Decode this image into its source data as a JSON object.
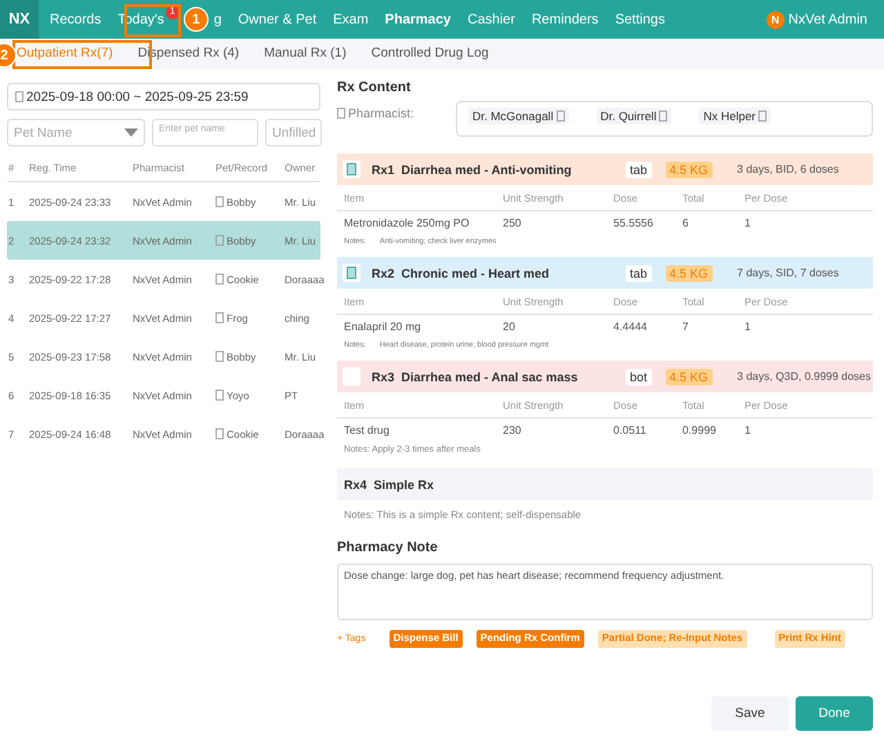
{
  "app": {
    "logo": "NX",
    "user_initial": "N",
    "user_name": "NxVet Admin"
  },
  "nav": [
    {
      "label": "Records",
      "selected": false
    },
    {
      "label": "Today's",
      "selected": false,
      "badge": "1"
    },
    {
      "label": "g",
      "selected": false
    },
    {
      "label": "Owner & Pet",
      "selected": false
    },
    {
      "label": "Exam",
      "selected": false
    },
    {
      "label": "Pharmacy",
      "selected": true
    },
    {
      "label": "Cashier",
      "selected": false
    },
    {
      "label": "Reminders",
      "selected": false
    },
    {
      "label": "Settings",
      "selected": false
    }
  ],
  "tabs": [
    {
      "label": "Outpatient Rx(7)",
      "selected": true
    },
    {
      "label": "Dispensed Rx (4)",
      "selected": false
    },
    {
      "label": "Manual Rx (1)",
      "selected": false
    },
    {
      "label": "Controlled Drug Log",
      "selected": false
    }
  ],
  "annotations": [
    {
      "label": "1"
    },
    {
      "label": "2"
    }
  ],
  "filters": {
    "date_range": "2025-09-18 00:00 ~ 2025-09-25 23:59",
    "pet_select": "Pet Name",
    "pet_input_placeholder": "Enter pet name",
    "status_select": "Unfilled"
  },
  "list": {
    "columns": [
      "#",
      "Reg. Time",
      "Pharmacist",
      "Pet/Record",
      "Owner"
    ],
    "rows": [
      {
        "num": "1",
        "time": "2025-09-24 23:33",
        "pharmacist": "NxVet Admin",
        "pet": "Bobby",
        "owner": "Mr. Liu",
        "selected": false
      },
      {
        "num": "2",
        "time": "2025-09-24 23:32",
        "pharmacist": "NxVet Admin",
        "pet": "Bobby",
        "owner": "Mr. Liu",
        "selected": true
      },
      {
        "num": "3",
        "time": "2025-09-22 17:28",
        "pharmacist": "NxVet Admin",
        "pet": "Cookie",
        "owner": "Doraaaa",
        "selected": false
      },
      {
        "num": "4",
        "time": "2025-09-22 17:27",
        "pharmacist": "NxVet Admin",
        "pet": "Frog",
        "owner": "ching",
        "selected": false
      },
      {
        "num": "5",
        "time": "2025-09-23 17:58",
        "pharmacist": "NxVet Admin",
        "pet": "Bobby",
        "owner": "Mr. Liu",
        "selected": false
      },
      {
        "num": "6",
        "time": "2025-09-18 16:35",
        "pharmacist": "NxVet Admin",
        "pet": "Yoyo",
        "owner": "PT",
        "selected": false
      },
      {
        "num": "7",
        "time": "2025-09-24 16:48",
        "pharmacist": "NxVet Admin",
        "pet": "Cookie",
        "owner": "Doraaaa",
        "selected": false
      }
    ]
  },
  "rx_content": {
    "title": "Rx Content",
    "pharmacist_label": "Pharmacist:",
    "pharmacists": [
      "Dr. McGonagall",
      "Dr. Quirrell",
      "Nx Helper"
    ],
    "prescriptions": [
      {
        "kind": "detailed",
        "code": "Rx1",
        "name": "Diarrhea med - Anti-vomiting",
        "form": "tab",
        "weight": "4.5 KG",
        "schedule": "3 days, BID, 6 doses",
        "color": "#fde5d8",
        "checked": true,
        "columns": [
          "Item",
          "Unit Strength",
          "Dose",
          "Total",
          "Per Dose"
        ],
        "items": [
          [
            "Metronidazole 250mg PO",
            "250",
            "55.5556",
            "6",
            "1"
          ]
        ],
        "notes_label": "Notes:",
        "notes": "Anti-vomiting; check liver enzymes"
      },
      {
        "kind": "detailed",
        "code": "Rx2",
        "name": "Chronic med - Heart med",
        "form": "tab",
        "weight": "4.5 KG",
        "schedule": "7 days, SID, 7 doses",
        "color": "#dbeffa",
        "checked": true,
        "columns": [
          "Item",
          "Unit Strength",
          "Dose",
          "Total",
          "Per Dose"
        ],
        "items": [
          [
            "Enalapril 20 mg",
            "20",
            "4.4444",
            "7",
            "1"
          ]
        ],
        "notes_label": "Notes:",
        "notes": "Heart disease, protein urine; blood pressure mgmt"
      },
      {
        "kind": "detailed",
        "code": "Rx3",
        "name": "Diarrhea med - Anal sac mass",
        "form": "bot",
        "weight": "4.5 KG",
        "schedule": "3 days, Q3D, 0.9999 doses",
        "color": "#fde4e4",
        "checked": false,
        "columns": [
          "Item",
          "Unit Strength",
          "Dose",
          "Total",
          "Per Dose"
        ],
        "items": [
          [
            "Test drug",
            "230",
            "0.0511",
            "0.9999",
            "1"
          ]
        ],
        "notes": "Notes: Apply 2-3 times after meals"
      },
      {
        "kind": "simple",
        "code": "Rx4",
        "name": "Simple Rx",
        "notes": "Notes: This is a simple Rx content; self-dispensable"
      }
    ]
  },
  "pharmacy_note": {
    "title": "Pharmacy Note",
    "value": "Dose change: large dog, pet has heart disease; recommend frequency adjustment."
  },
  "tags": {
    "add_label": "+ Tags",
    "items": [
      {
        "label": "Dispense Bill",
        "kind": "solid"
      },
      {
        "label": "Pending Rx Confirm",
        "kind": "solid"
      },
      {
        "label": "Partial Done; Re-Input Notes",
        "kind": "light"
      },
      {
        "label": "Print Rx Hint",
        "kind": "light"
      }
    ]
  },
  "buttons": [
    {
      "label": "Save",
      "kind": "secondary"
    },
    {
      "label": "Done",
      "kind": "primary"
    }
  ]
}
